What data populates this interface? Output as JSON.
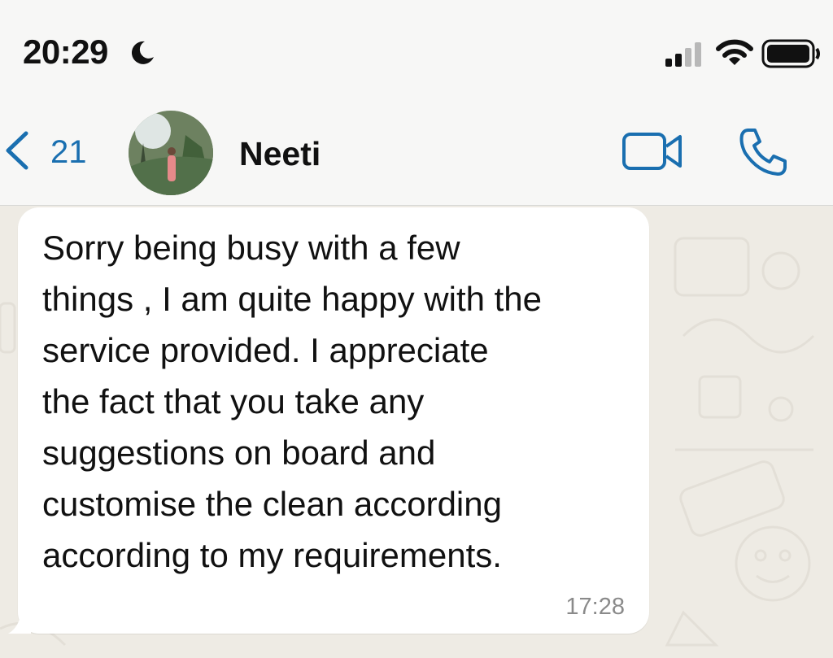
{
  "status_bar": {
    "time": "20:29",
    "icons": [
      "moon-icon",
      "signal-icon",
      "wifi-icon",
      "battery-icon"
    ]
  },
  "header": {
    "back_count": "21",
    "contact_name": "Neeti",
    "icons": [
      "back-chevron-icon",
      "video-call-icon",
      "phone-call-icon"
    ],
    "accent_color": "#1a6fb0"
  },
  "message": {
    "text": "Sorry being busy with a few\nthings , I am quite happy with the\nservice provided. I appreciate\nthe fact that you take any\nsuggestions on board and\ncustomise the clean according\naccording to my requirements.",
    "time": "17:28"
  }
}
